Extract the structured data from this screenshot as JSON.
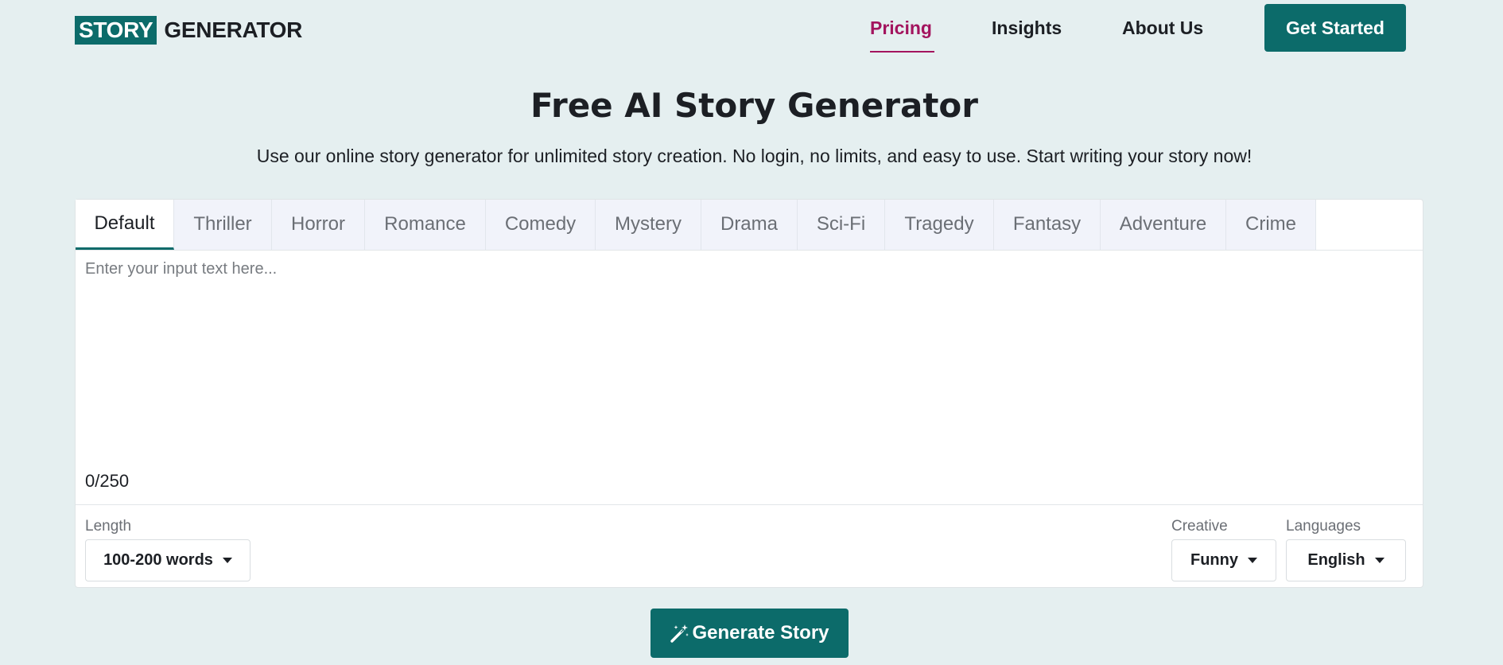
{
  "header": {
    "logo_box": "STORY",
    "logo_rest": "GENERATOR",
    "nav": [
      "Pricing",
      "Insights",
      "About Us"
    ],
    "cta": "Get Started",
    "colors": {
      "accent": "#0c6b6a",
      "active_nav": "#a3145e",
      "background": "#e5eff0"
    }
  },
  "hero": {
    "title": "Free AI Story Generator",
    "subtitle": "Use our online story generator for unlimited story creation. No login, no limits, and easy to use. Start writing your story now!"
  },
  "tabs": [
    "Default",
    "Thriller",
    "Horror",
    "Romance",
    "Comedy",
    "Mystery",
    "Drama",
    "Sci-Fi",
    "Tragedy",
    "Fantasy",
    "Adventure",
    "Crime"
  ],
  "active_tab": "Default",
  "input": {
    "placeholder": "Enter your input text here...",
    "value": "",
    "counter": "0/250"
  },
  "options": {
    "length_label": "Length",
    "length_value": "100-200 words",
    "creative_label": "Creative",
    "creative_value": "Funny",
    "languages_label": "Languages",
    "languages_value": "English"
  },
  "generate": {
    "label": "Generate Story",
    "icon": "magic-wand-icon"
  }
}
